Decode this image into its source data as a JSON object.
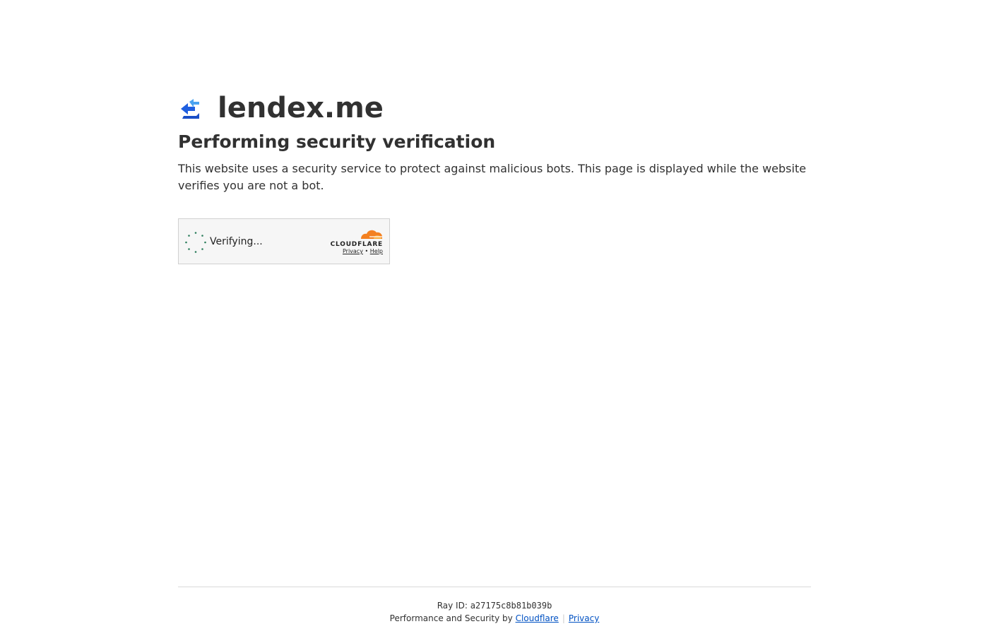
{
  "site": {
    "name": "lendex.me",
    "logo_icon": "lendex-logo-icon"
  },
  "page": {
    "title": "Performing security verification",
    "description": "This website uses a security service to protect against malicious bots. This page is displayed while the website verifies you are not a bot."
  },
  "widget": {
    "status_text": "Verifying...",
    "brand": "CLOUDFLARE",
    "privacy_link": "Privacy",
    "separator": "•",
    "help_link": "Help",
    "spinner_icon": "loading-spinner-icon"
  },
  "footer": {
    "ray_label": "Ray ID:",
    "ray_id": "a27175c8b81b039b",
    "performance_text": "Performance and Security by",
    "cloudflare_link": "Cloudflare",
    "divider": "|",
    "privacy_link": "Privacy"
  },
  "colors": {
    "text": "#313131",
    "link": "#0051c3",
    "cloudflare_orange": "#f38020",
    "spinner_green": "#2c7e5c",
    "logo_blue": "#2c6df0"
  }
}
